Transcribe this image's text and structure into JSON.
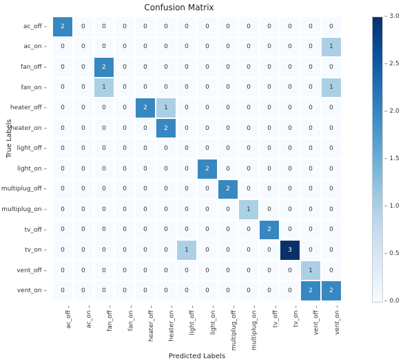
{
  "chart_data": {
    "type": "heatmap",
    "title": "Confusion Matrix",
    "xlabel": "Predicted Labels",
    "ylabel": "True Labels",
    "labels": [
      "ac_off",
      "ac_on",
      "fan_off",
      "fan_on",
      "heater_off",
      "heater_on",
      "light_off",
      "light_on",
      "multiplug_off",
      "multiplug_on",
      "tv_off",
      "tv_on",
      "vent_off",
      "vent_on"
    ],
    "matrix": [
      [
        2,
        0,
        0,
        0,
        0,
        0,
        0,
        0,
        0,
        0,
        0,
        0,
        0,
        0
      ],
      [
        0,
        0,
        0,
        0,
        0,
        0,
        0,
        0,
        0,
        0,
        0,
        0,
        0,
        1
      ],
      [
        0,
        0,
        2,
        0,
        0,
        0,
        0,
        0,
        0,
        0,
        0,
        0,
        0,
        0
      ],
      [
        0,
        0,
        1,
        0,
        0,
        0,
        0,
        0,
        0,
        0,
        0,
        0,
        0,
        1
      ],
      [
        0,
        0,
        0,
        0,
        2,
        1,
        0,
        0,
        0,
        0,
        0,
        0,
        0,
        0
      ],
      [
        0,
        0,
        0,
        0,
        0,
        2,
        0,
        0,
        0,
        0,
        0,
        0,
        0,
        0
      ],
      [
        0,
        0,
        0,
        0,
        0,
        0,
        0,
        0,
        0,
        0,
        0,
        0,
        0,
        0
      ],
      [
        0,
        0,
        0,
        0,
        0,
        0,
        0,
        2,
        0,
        0,
        0,
        0,
        0,
        0
      ],
      [
        0,
        0,
        0,
        0,
        0,
        0,
        0,
        0,
        2,
        0,
        0,
        0,
        0,
        0
      ],
      [
        0,
        0,
        0,
        0,
        0,
        0,
        0,
        0,
        0,
        1,
        0,
        0,
        0,
        0
      ],
      [
        0,
        0,
        0,
        0,
        0,
        0,
        0,
        0,
        0,
        0,
        2,
        0,
        0,
        0
      ],
      [
        0,
        0,
        0,
        0,
        0,
        0,
        1,
        0,
        0,
        0,
        0,
        3,
        0,
        0
      ],
      [
        0,
        0,
        0,
        0,
        0,
        0,
        0,
        0,
        0,
        0,
        0,
        0,
        1,
        0
      ],
      [
        0,
        0,
        0,
        0,
        0,
        0,
        0,
        0,
        0,
        0,
        0,
        0,
        2,
        2
      ]
    ],
    "vmin": 0,
    "vmax": 3,
    "colorbar_ticks": [
      0.0,
      0.5,
      1.0,
      1.5,
      2.0,
      2.5,
      3.0
    ],
    "colorbar_tick_labels": [
      "0.0",
      "0.5",
      "1.0",
      "1.5",
      "2.0",
      "2.5",
      "3.0"
    ]
  }
}
